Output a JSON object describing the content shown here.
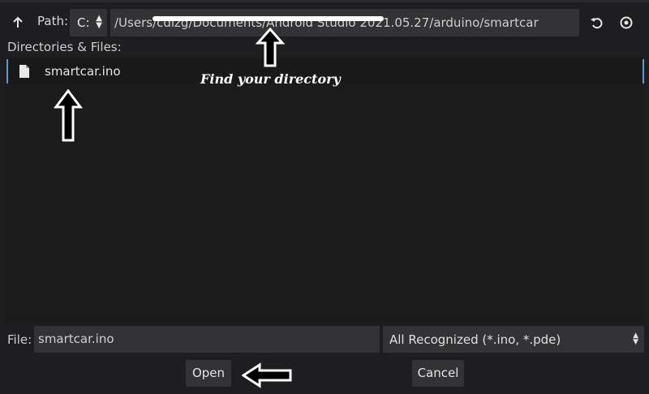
{
  "toolbar": {
    "up_icon": "arrow-up-icon",
    "path_label": "Path:",
    "drive_value": "C:",
    "path_value": "/Users/cdizg/Documents/Android Studio 2021.05.27/arduino/smartcar",
    "refresh_icon": "refresh-icon",
    "toggle_hidden_icon": "eye-icon"
  },
  "browser": {
    "label": "Directories & Files:",
    "items": [
      {
        "name": "smartcar.ino",
        "icon": "file-icon"
      }
    ]
  },
  "annotations": {
    "note": "Find your directory"
  },
  "footer": {
    "file_label": "File:",
    "file_value": "smartcar.ino",
    "filter_value": "All Recognized (*.ino, *.pde)",
    "open_label": "Open",
    "cancel_label": "Cancel"
  },
  "colors": {
    "background": "#1e1e20",
    "field": "#333335",
    "selection_edge": "#5a9bd4",
    "annotation": "#ffffff"
  }
}
